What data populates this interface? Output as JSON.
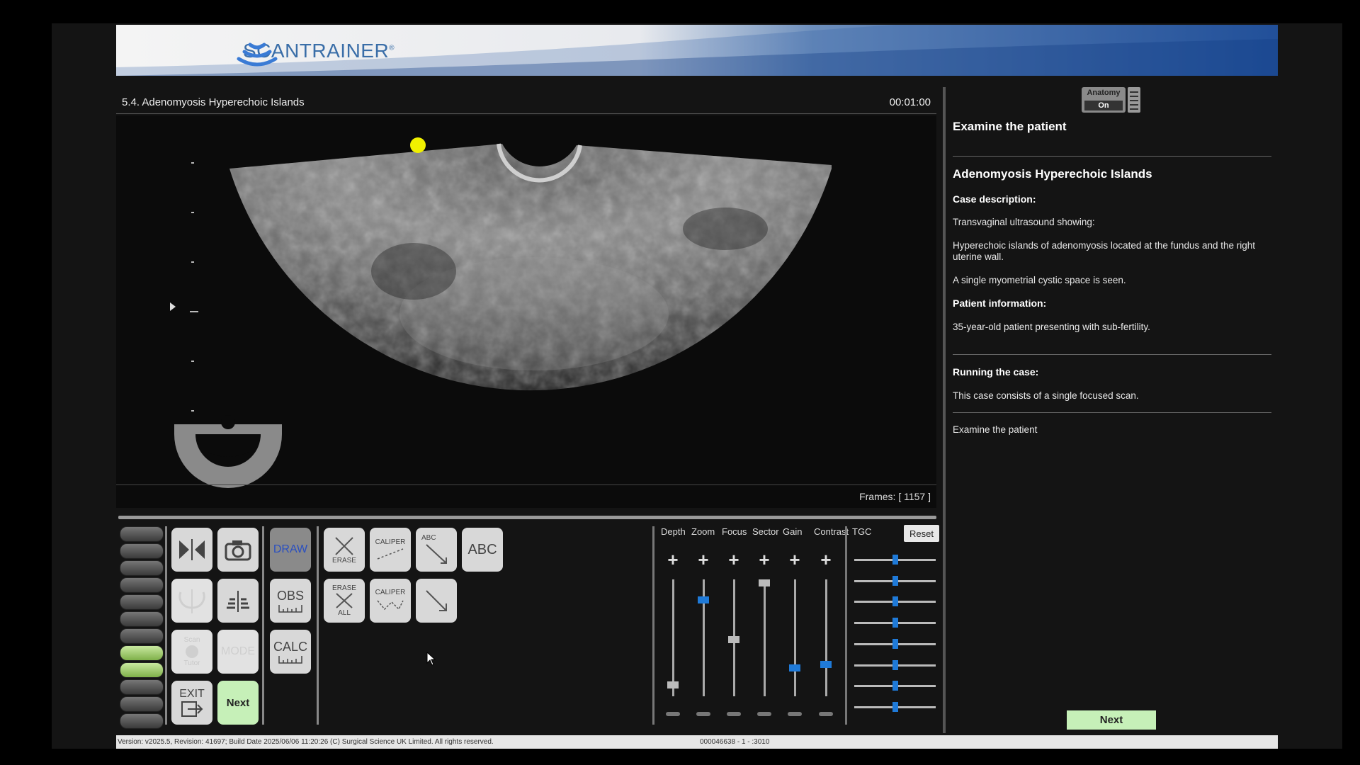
{
  "header": {
    "brand": "SCANTRAINER",
    "brand_mark": "®"
  },
  "case": {
    "title": "5.4. Adenomyosis Hyperechoic Islands",
    "timer": "00:01:00"
  },
  "viewport": {
    "frames_label": "Frames: [ 1157 ]"
  },
  "tools": {
    "draw": "DRAW",
    "erase": "ERASE",
    "caliper": "CALIPER",
    "abc_small": "ABC",
    "abc": "ABC",
    "erase_all_top": "ERASE",
    "erase_all_bottom": "ALL",
    "caliper2": "CALIPER",
    "obs": "OBS",
    "calc": "CALC",
    "scan": "Scan",
    "tutor": "Tutor",
    "mode": "MODE",
    "exit": "EXIT",
    "next": "Next"
  },
  "sliders": {
    "labels": [
      "Depth",
      "Zoom",
      "Focus",
      "Sector",
      "Gain",
      "Contrast"
    ],
    "levels": [
      0.1,
      0.85,
      0.5,
      1.0,
      0.25,
      0.28
    ],
    "tgc_label": "TGC",
    "reset": "Reset",
    "tgc_levels": [
      0.5,
      0.5,
      0.5,
      0.5,
      0.5,
      0.5,
      0.5,
      0.5
    ]
  },
  "right_panel": {
    "anatomy_label": "Anatomy",
    "anatomy_state": "On",
    "instruction": "Examine the patient",
    "case_title": "Adenomyosis Hyperechoic Islands",
    "case_description_heading": "Case description:",
    "desc_1": "Transvaginal ultrasound showing:",
    "desc_2": "Hyperechoic islands of adenomyosis located at the fundus and the right uterine wall.",
    "desc_3": "A single myometrial cystic space is seen.",
    "patient_info_heading": "Patient information:",
    "patient_info": "35-year-old patient presenting with sub-fertility.",
    "running_heading": "Running the case:",
    "running_text": "This case consists of a single focused scan.",
    "task": "Examine the patient",
    "next": "Next"
  },
  "footer": {
    "version": "Version: v2025.5, Revision: 41697; Build Date 2025/06/06 11:20:26 (C) Surgical Science UK Limited. All rights reserved.",
    "code": "000046638  - 1 -  :3010"
  },
  "colors": {
    "accent_blue": "#1f7ad8",
    "next_green": "#c6f0b8",
    "probe_marker": "#f0f000"
  }
}
